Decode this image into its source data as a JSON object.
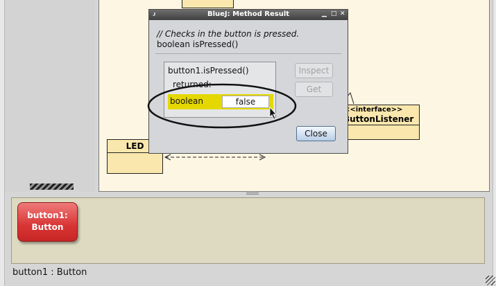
{
  "diagram": {
    "classes": {
      "led": {
        "name": "LED"
      },
      "listener": {
        "stereotype": "<<interface>>",
        "name": "ButtonListener"
      }
    },
    "bench_object": {
      "label_line1": "button1:",
      "label_line2": "Button"
    }
  },
  "status": {
    "text": "button1 : Button"
  },
  "dialog": {
    "title": "BlueJ:  Method Result",
    "window_buttons": {
      "minimize": "▁",
      "maximize": "□",
      "close": "✕"
    },
    "comment": "// Checks in the button is pressed.",
    "signature": "boolean isPressed()",
    "call": "button1.isPressed()",
    "returned_label": "returned:",
    "result_type": "boolean",
    "result_value": "false",
    "inspect_label": "Inspect",
    "get_label": "Get",
    "close_label": "Close"
  },
  "colors": {
    "canvas_bg": "#fdf6e3",
    "class_fill": "#f9e7ad",
    "object_red": "#d83434",
    "highlight_yellow": "#e5d800",
    "bench_bg": "#dedac1"
  }
}
